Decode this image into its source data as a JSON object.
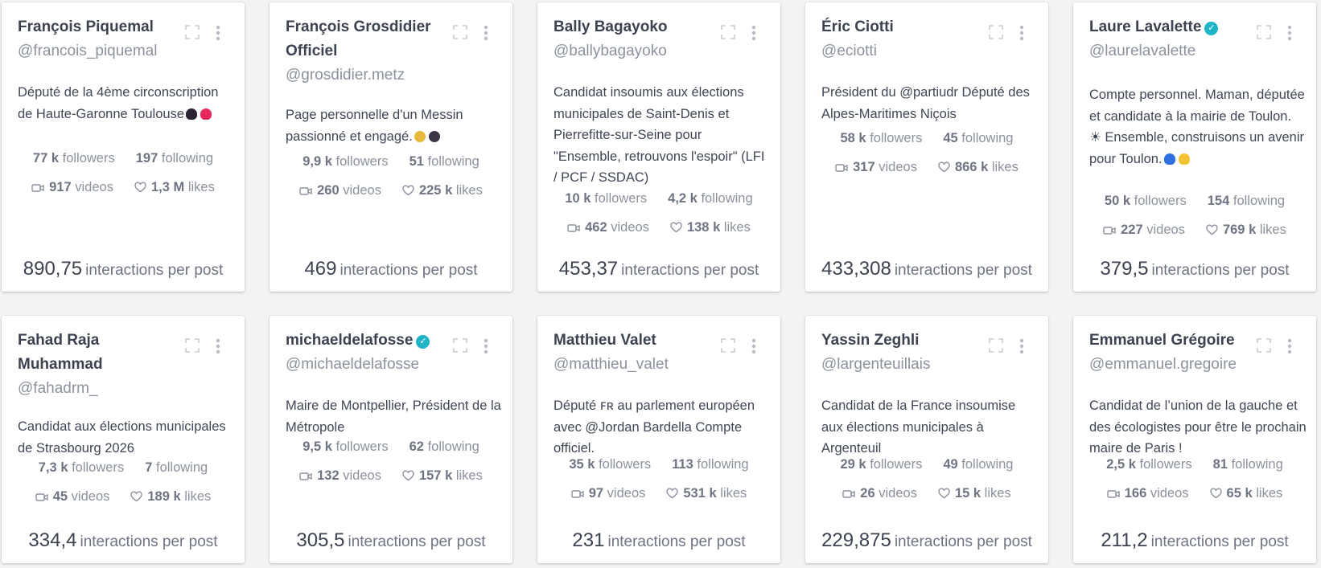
{
  "ipp_label": "interactions per post",
  "followers_label": "followers",
  "following_label": "following",
  "videos_label": "videos",
  "likes_label": "likes",
  "cards": [
    {
      "name": "François Piquemal",
      "handle": "@francois_piquemal",
      "verified": false,
      "bio": "Député de la 4ème circonscription de Haute-Garonne Toulouse",
      "bio_emojis": [
        "black-heart",
        "red-heart"
      ],
      "followers": "77 k",
      "following": "197",
      "videos": "917",
      "likes": "1,3 M",
      "ipp": "890,75"
    },
    {
      "name": "François Grosdidier Officiel",
      "handle": "@grosdidier.metz",
      "verified": false,
      "bio": "Page personnelle d'un Messin passionné et engagé.",
      "bio_emojis": [
        "yellow-circle",
        "black-circle"
      ],
      "followers": "9,9 k",
      "following": "51",
      "videos": "260",
      "likes": "225 k",
      "ipp": "469"
    },
    {
      "name": "Bally Bagayoko",
      "handle": "@ballybagayoko",
      "verified": false,
      "bio": "Candidat insoumis aux élections municipales de Saint-Denis et Pierrefitte-sur-Seine pour \"Ensemble, retrouvons l'espoir\" (LFI / PCF / SSDAC)",
      "bio_emojis": [],
      "followers": "10 k",
      "following": "4,2 k",
      "videos": "462",
      "likes": "138 k",
      "ipp": "453,37"
    },
    {
      "name": "Éric Ciotti",
      "handle": "@eciotti",
      "verified": false,
      "bio": "Président du @partiudr Député des Alpes-Maritimes Niçois",
      "bio_emojis": [],
      "followers": "58 k",
      "following": "45",
      "videos": "317",
      "likes": "866 k",
      "ipp": "433,308"
    },
    {
      "name": "Laure Lavalette",
      "handle": "@laurelavalette",
      "verified": true,
      "bio": "Compte personnel. Maman, députée et candidate à la mairie de Toulon. ☀ Ensemble, construisons un avenir pour Toulon.",
      "bio_emojis": [
        "blue-heart",
        "yellow-heart"
      ],
      "followers": "50 k",
      "following": "154",
      "videos": "227",
      "likes": "769 k",
      "ipp": "379,5"
    },
    {
      "name": "Fahad Raja Muhammad",
      "handle": "@fahadrm_",
      "verified": false,
      "bio": "Candidat aux élections municipales de Strasbourg 2026",
      "bio_emojis": [],
      "followers": "7,3 k",
      "following": "7",
      "videos": "45",
      "likes": "189 k",
      "ipp": "334,4"
    },
    {
      "name": "michaeldelafosse",
      "handle": "@michaeldelafosse",
      "verified": true,
      "bio": "Maire de Montpellier, Président de la Métropole",
      "bio_emojis": [],
      "followers": "9,5 k",
      "following": "62",
      "videos": "132",
      "likes": "157 k",
      "ipp": "305,5"
    },
    {
      "name": "Matthieu Valet",
      "handle": "@matthieu_valet",
      "verified": false,
      "bio": "Député ꜰʀ au parlement européen avec @Jordan Bardella Compte officiel.",
      "bio_emojis": [],
      "followers": "35 k",
      "following": "113",
      "videos": "97",
      "likes": "531 k",
      "ipp": "231"
    },
    {
      "name": "Yassin Zeghli",
      "handle": "@largenteuillais",
      "verified": false,
      "bio": "Candidat de la France insoumise aux élections municipales à Argenteuil",
      "bio_emojis": [],
      "followers": "29 k",
      "following": "49",
      "videos": "26",
      "likes": "15 k",
      "ipp": "229,875"
    },
    {
      "name": "Emmanuel Grégoire",
      "handle": "@emmanuel.gregoire",
      "verified": false,
      "bio": "Candidat de l’union de la gauche et des écologistes pour être le prochain maire de Paris !",
      "bio_emojis": [],
      "followers": "2,5 k",
      "following": "81",
      "videos": "166",
      "likes": "65 k",
      "ipp": "211,2"
    }
  ],
  "colors": {
    "verified": "#1fb5c7",
    "card_bg": "#ffffff",
    "page_bg": "#f2f3f5"
  }
}
